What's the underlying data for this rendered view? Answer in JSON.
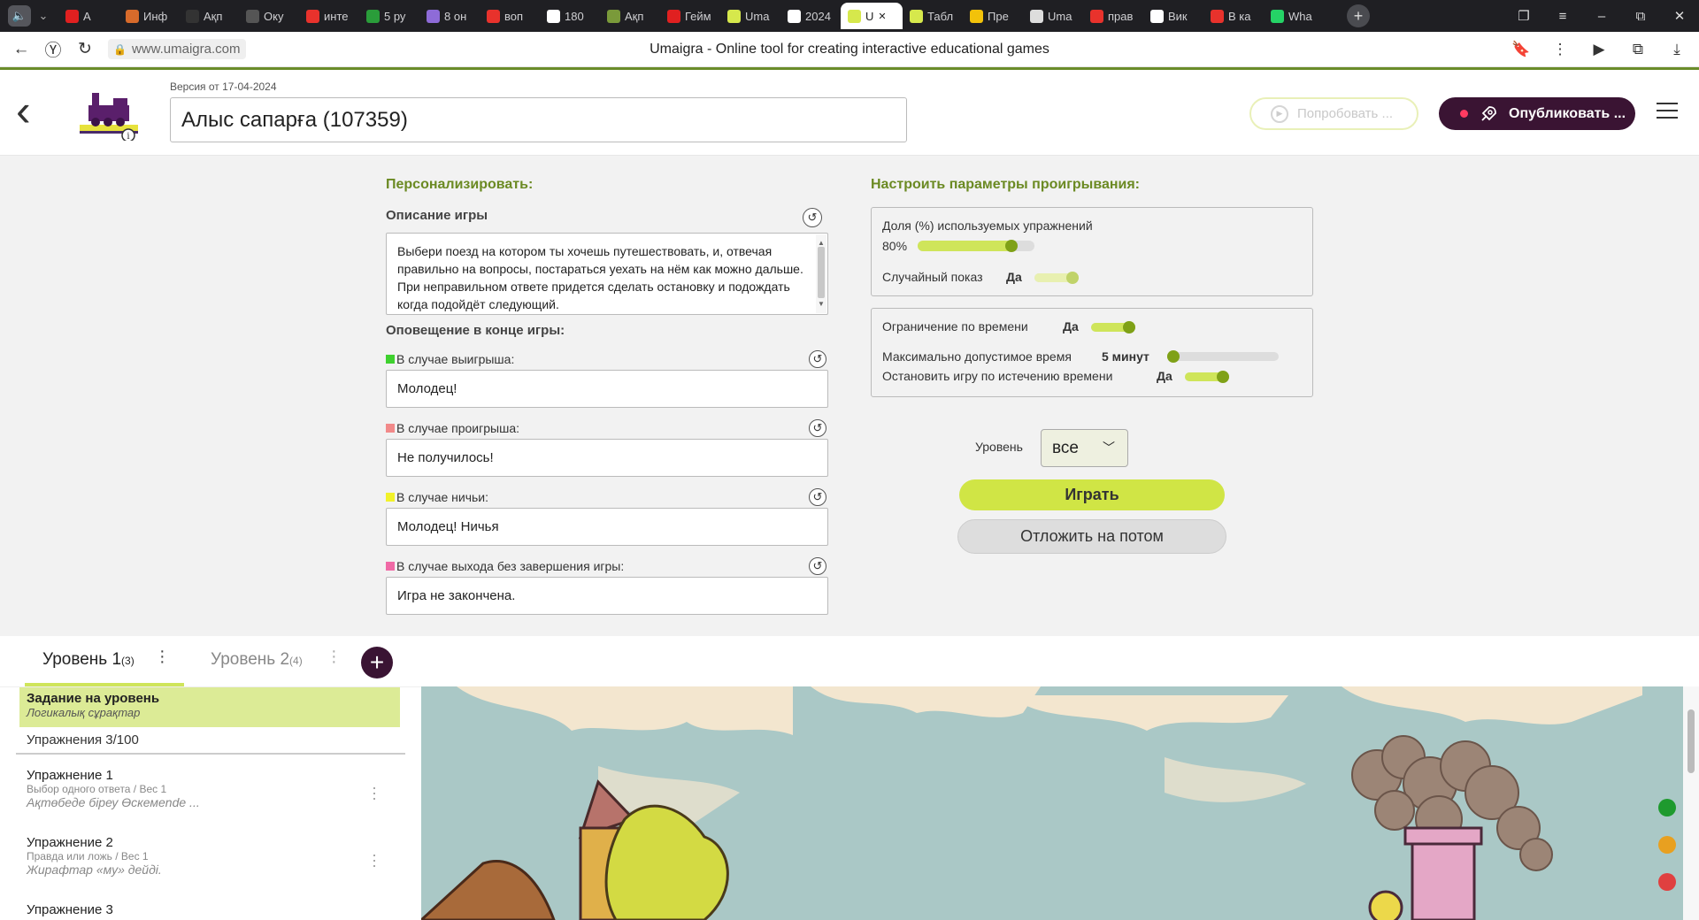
{
  "browser": {
    "tabs": [
      {
        "label": "A",
        "color": "#e02020",
        "icon": "youtube-icon"
      },
      {
        "label": "Инф",
        "color": "#d86b2b",
        "icon": "book-icon"
      },
      {
        "label": "Ақп",
        "color": "#333333",
        "icon": "pkp-icon"
      },
      {
        "label": "Оку",
        "color": "#555555",
        "icon": "building-icon"
      },
      {
        "label": "инте",
        "color": "#e8322c",
        "icon": "yandex-icon"
      },
      {
        "label": "5 ру",
        "color": "#2a9d3a",
        "icon": "grid-icon"
      },
      {
        "label": "8 он",
        "color": "#8e6bd8",
        "icon": "chat-icon"
      },
      {
        "label": "воп",
        "color": "#e8322c",
        "icon": "yandex-icon"
      },
      {
        "label": "180",
        "color": "#ffffff",
        "icon": "google-icon"
      },
      {
        "label": "Ақп",
        "color": "#7a9a3a",
        "icon": "diamond-icon"
      },
      {
        "label": "Гейм",
        "color": "#e02020",
        "icon": "youtube-icon"
      },
      {
        "label": "Uma",
        "color": "#d6e84c",
        "icon": "umaigra-icon"
      },
      {
        "label": "2024",
        "color": "#ffffff",
        "icon": "google-icon"
      },
      {
        "label": "U",
        "color": "#d6e84c",
        "icon": "umaigra-icon"
      },
      {
        "label": "Табл",
        "color": "#d6e84c",
        "icon": "umaigra-icon"
      },
      {
        "label": "Пре",
        "color": "#f2c20a",
        "icon": "info-icon"
      },
      {
        "label": "Uma",
        "color": "#dddddd",
        "icon": "doc-icon"
      },
      {
        "label": "прав",
        "color": "#e8322c",
        "icon": "yandex-icon"
      },
      {
        "label": "Вик",
        "color": "#ffffff",
        "icon": "google-icon"
      },
      {
        "label": "В ка",
        "color": "#e8322c",
        "icon": "yandex-icon"
      },
      {
        "label": "Wha",
        "color": "#25d366",
        "icon": "whatsapp-icon"
      }
    ],
    "url": "www.umaigra.com",
    "page_title": "Umaigra - Online tool for creating interactive educational games"
  },
  "header": {
    "version": "Версия от 17-04-2024",
    "game_title": "Алыс сапарға (107359)",
    "try_label": "Попробовать ...",
    "publish_label": "Опубликовать ..."
  },
  "personalize": {
    "title": "Персонализировать:",
    "description_label": "Описание игры",
    "description_text": "Выбери поезд на котором ты хочешь путешествовать, и, отвечая правильно на вопросы, постараться уехать на нём как можно дальше. При неправильном ответе придется сделать остановку и подождать когда подойдёт следующий.",
    "end_notice_label": "Оповещение в конце игры:",
    "messages": [
      {
        "label": "В случае выигрыша:",
        "value": "Молодец!",
        "color": "#3fd12f"
      },
      {
        "label": "В случае проигрыша:",
        "value": "Не получилось!",
        "color": "#f28a8a"
      },
      {
        "label": "В случае ничьи:",
        "value": "Молодец! Ничья",
        "color": "#f2f22a"
      },
      {
        "label": "В случае выхода без завершения игры:",
        "value": "Игра не закончена.",
        "color": "#f06aa6"
      }
    ]
  },
  "playback": {
    "title": "Настроить параметры проигрывания:",
    "share_label": "Доля (%) используемых упражнений",
    "share_value": "80%",
    "share_fraction": 0.8,
    "random_label": "Случайный показ",
    "random_value": "Да",
    "time_limit_label": "Ограничение по времени",
    "time_limit_value": "Да",
    "max_time_label": "Максимально допустимое время",
    "max_time_value": "5 минут",
    "max_time_fraction": 0.05,
    "stop_label": "Остановить игру по истечению времени",
    "stop_value": "Да",
    "level_label": "Уровень",
    "level_value": "все",
    "play_label": "Играть",
    "later_label": "Отложить на потом"
  },
  "levels": {
    "tabs": [
      {
        "label": "Уровень 1",
        "count": "(3)"
      },
      {
        "label": "Уровень 2",
        "count": "(4)"
      }
    ]
  },
  "exercises": {
    "task_title": "Задание на уровень",
    "task_subtitle": "Логикалық сұрақтар",
    "count_label": "Упражнения 3/100",
    "items": [
      {
        "name": "Упражнение 1",
        "meta": "Выбор одного ответа / Вес 1",
        "question": "Ақтөбеде біреу Өскемende ..."
      },
      {
        "name": "Упражнение 2",
        "meta": "Правда или ложь / Вес 1",
        "question": "Жирафтар «му» дейді."
      },
      {
        "name": "Упражнение 3",
        "meta": "",
        "question": ""
      }
    ]
  },
  "status_dots": [
    "#1e9a2e",
    "#e8a020",
    "#e04040"
  ]
}
